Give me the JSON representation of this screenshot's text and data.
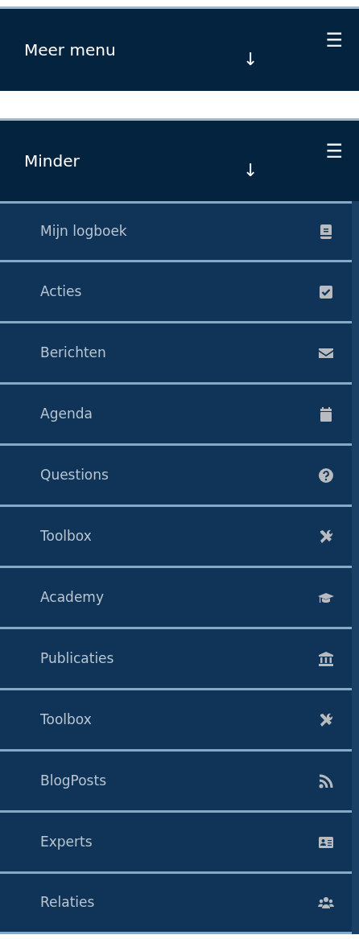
{
  "collapsed_bar": {
    "title": "Meer menu",
    "arrow": "↓",
    "menu": "☰"
  },
  "expanded_bar": {
    "title": "Minder",
    "arrow": "↓",
    "menu": "☰"
  },
  "menu_items": [
    {
      "label": "Mijn logboek"
    },
    {
      "label": "Acties"
    },
    {
      "label": "Berichten"
    },
    {
      "label": "Agenda"
    },
    {
      "label": "Questions"
    },
    {
      "label": "Toolbox"
    },
    {
      "label": "Academy"
    },
    {
      "label": "Publicaties"
    },
    {
      "label": "Toolbox"
    },
    {
      "label": "BlogPosts"
    },
    {
      "label": "Experts"
    },
    {
      "label": "Relaties"
    }
  ]
}
